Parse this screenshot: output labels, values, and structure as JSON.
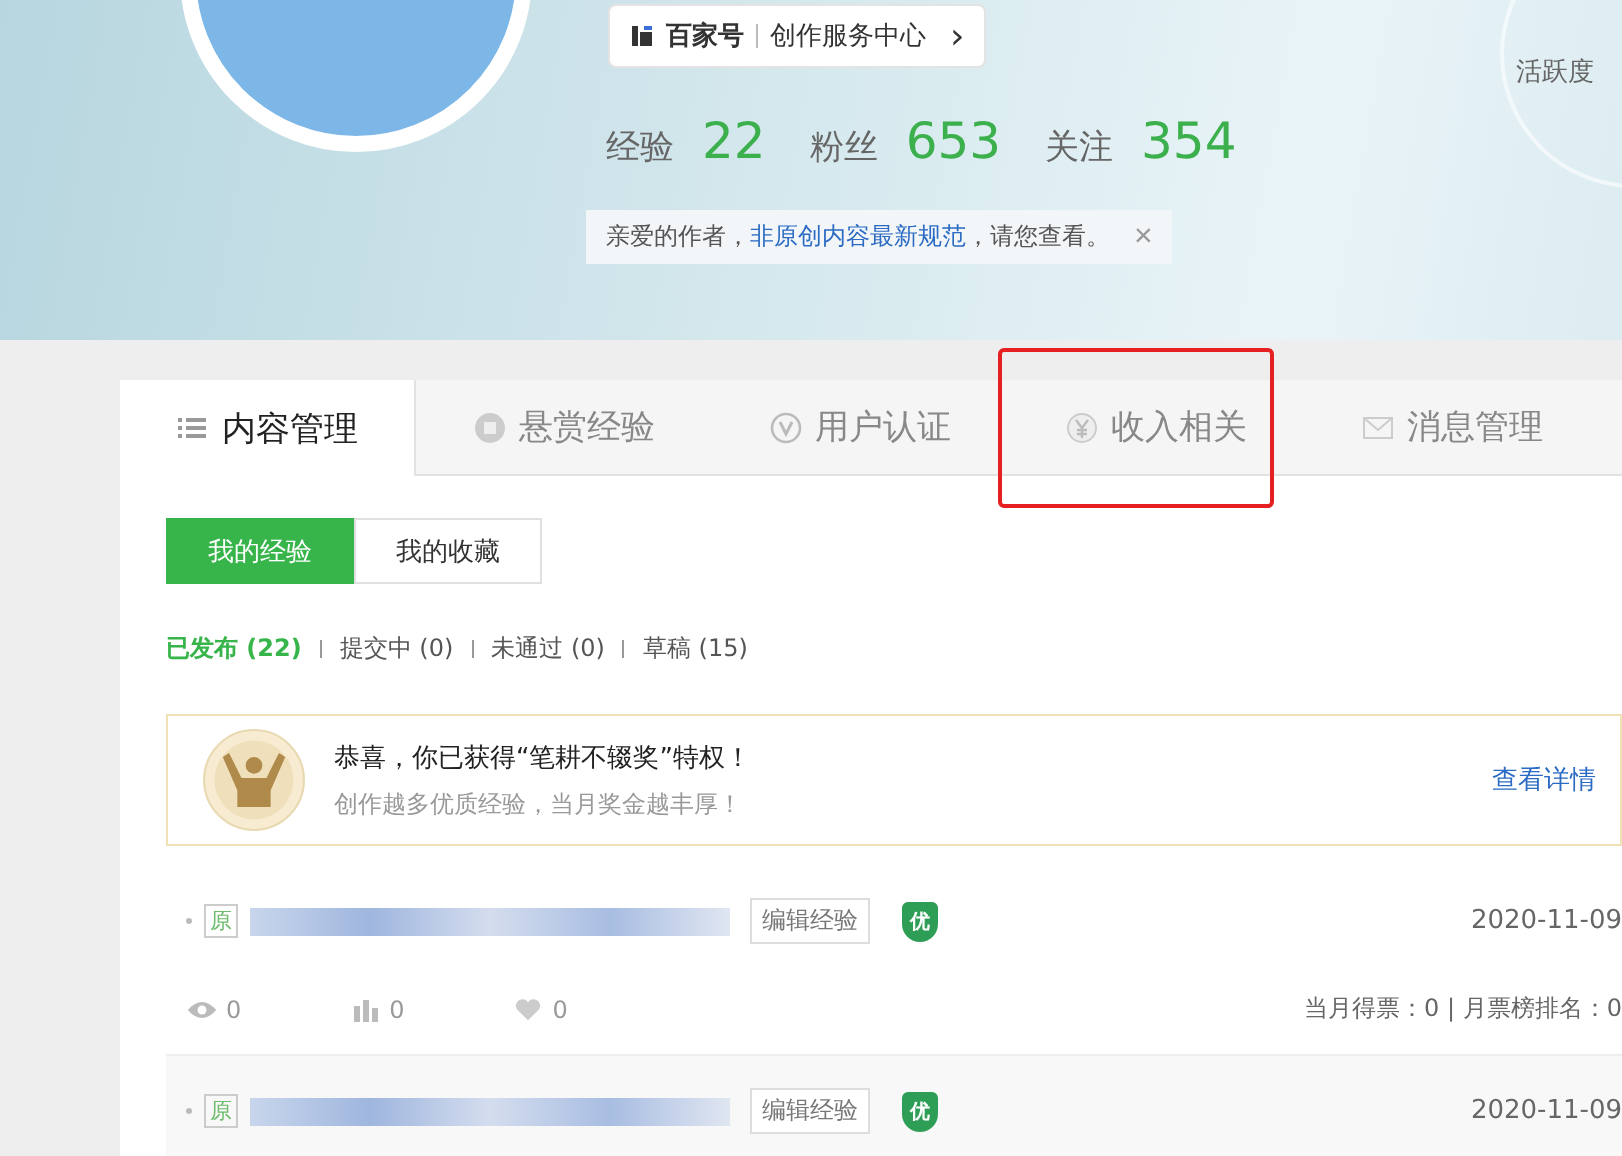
{
  "profile": {
    "service_link": {
      "brand": "百家号",
      "label": "创作服务中心",
      "arrow": "›"
    },
    "stats": [
      {
        "label": "经验",
        "value": "22"
      },
      {
        "label": "粉丝",
        "value": "653"
      },
      {
        "label": "关注",
        "value": "354"
      }
    ],
    "notice": {
      "text": "亲爱的作者，",
      "link": "非原创内容最新规范",
      "tail": "，请您查看。",
      "close": "×"
    },
    "activity_label": "活跃度"
  },
  "tabs": [
    {
      "label": "内容管理",
      "kind": "list",
      "selected": true,
      "highlighted": false
    },
    {
      "label": "悬赏经验",
      "kind": "reward",
      "selected": false,
      "highlighted": false
    },
    {
      "label": "用户认证",
      "kind": "verify",
      "selected": false,
      "highlighted": false
    },
    {
      "label": "收入相关",
      "kind": "yuan",
      "selected": false,
      "highlighted": true
    },
    {
      "label": "消息管理",
      "kind": "mail",
      "selected": false,
      "highlighted": false
    }
  ],
  "segments": [
    {
      "label": "我的经验",
      "selected": true
    },
    {
      "label": "我的收藏",
      "selected": false
    }
  ],
  "filters": [
    {
      "label": "已发布",
      "count": "(22)",
      "selected": true
    },
    {
      "label": "提交中",
      "count": "(0)",
      "selected": false
    },
    {
      "label": "未通过",
      "count": "(0)",
      "selected": false
    },
    {
      "label": "草稿",
      "count": "(15)",
      "selected": false
    }
  ],
  "banner": {
    "title": "恭喜，你已获得“笔耕不辍奖”特权！",
    "subtitle": "创作越多优质经验，当月奖金越丰厚！",
    "link": "查看详情"
  },
  "entries": [
    {
      "badge": "原",
      "edit": "编辑经验",
      "quality": "优",
      "date": "2020-11-09",
      "stats": {
        "views": "0",
        "votes": "0",
        "likes": "0",
        "ranking": "当月得票：0 | 月票榜排名：0"
      }
    },
    {
      "badge": "原",
      "edit": "编辑经验",
      "quality": "优",
      "date": "2020-11-09"
    }
  ]
}
